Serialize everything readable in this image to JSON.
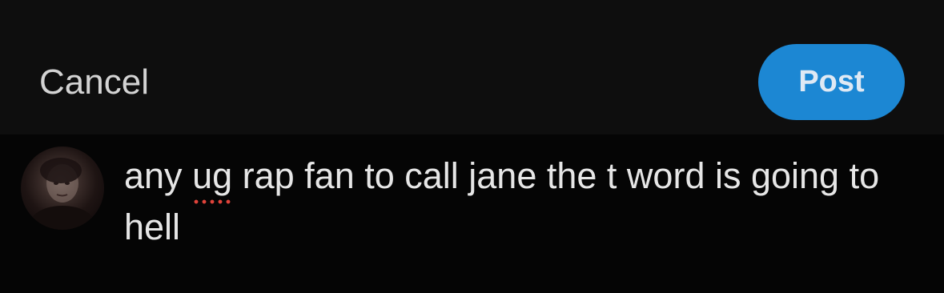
{
  "header": {
    "cancel_label": "Cancel",
    "post_label": "Post"
  },
  "composer": {
    "text_before": "any ",
    "misspelled_word": "ug",
    "text_after": " rap fan to call jane the t word is going to hell"
  },
  "colors": {
    "background": "#050505",
    "header_background": "#0e0e0e",
    "post_button": "#1c87d3",
    "spellcheck_underline": "#e0433a",
    "text": "#e6e6e6"
  }
}
